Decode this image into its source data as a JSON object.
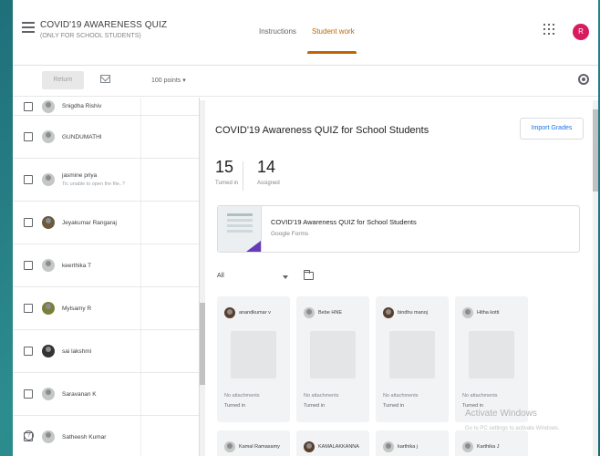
{
  "header": {
    "title": "COVID'19 AWARENESS QUIZ",
    "subtitle": "(ONLY FOR SCHOOL STUDENTS)",
    "tabs": [
      {
        "label": "Instructions"
      },
      {
        "label": "Student work"
      }
    ],
    "avatar_letter": "R",
    "accent_color": "#c26401",
    "avatar_color": "#d81b60"
  },
  "toolbar": {
    "return_label": "Return",
    "points": "100 points"
  },
  "students": [
    {
      "name": "Snigdha Rishiv",
      "note": ""
    },
    {
      "name": "GUNDUMATHI",
      "note": ""
    },
    {
      "name": "jasmine priya",
      "note": "Tic unable to open the file..?"
    },
    {
      "name": "Jeyakumar Rangaraj",
      "note": ""
    },
    {
      "name": "keerthika T",
      "note": ""
    },
    {
      "name": "Mylsamy R",
      "note": ""
    },
    {
      "name": "sai lakshmi",
      "note": ""
    },
    {
      "name": "Saravanan K",
      "note": ""
    },
    {
      "name": "Satheesh Kumar",
      "note": ""
    }
  ],
  "assignment": {
    "title": "COVID'19 Awareness QUIZ for School Students",
    "import_label": "Import Grades",
    "turned_in": "15",
    "turned_in_label": "Turned in",
    "assigned": "14",
    "assigned_label": "Assigned",
    "attachment_title": "COVID'19 Awareness QUIZ for School Students",
    "attachment_type": "Google Forms"
  },
  "filter": {
    "selected": "All"
  },
  "cards": [
    {
      "name": "anandkumar v",
      "attachments": "No attachments",
      "status": "Turned in"
    },
    {
      "name": "Bebe HNE",
      "attachments": "No attachments",
      "status": "Turned in"
    },
    {
      "name": "bindhu manoj",
      "attachments": "No attachments",
      "status": "Turned in"
    },
    {
      "name": "Hitha kotti",
      "attachments": "No attachments",
      "status": "Turned in"
    },
    {
      "name": "Kamal Ramasamy",
      "attachments": "",
      "status": ""
    },
    {
      "name": "KAMALAKKANNA",
      "attachments": "",
      "status": ""
    },
    {
      "name": "karthika j",
      "attachments": "",
      "status": ""
    },
    {
      "name": "Karthika J",
      "attachments": "",
      "status": ""
    }
  ],
  "watermark": {
    "line1": "Activate Windows",
    "line2": "Go to PC settings to activate Windows."
  }
}
